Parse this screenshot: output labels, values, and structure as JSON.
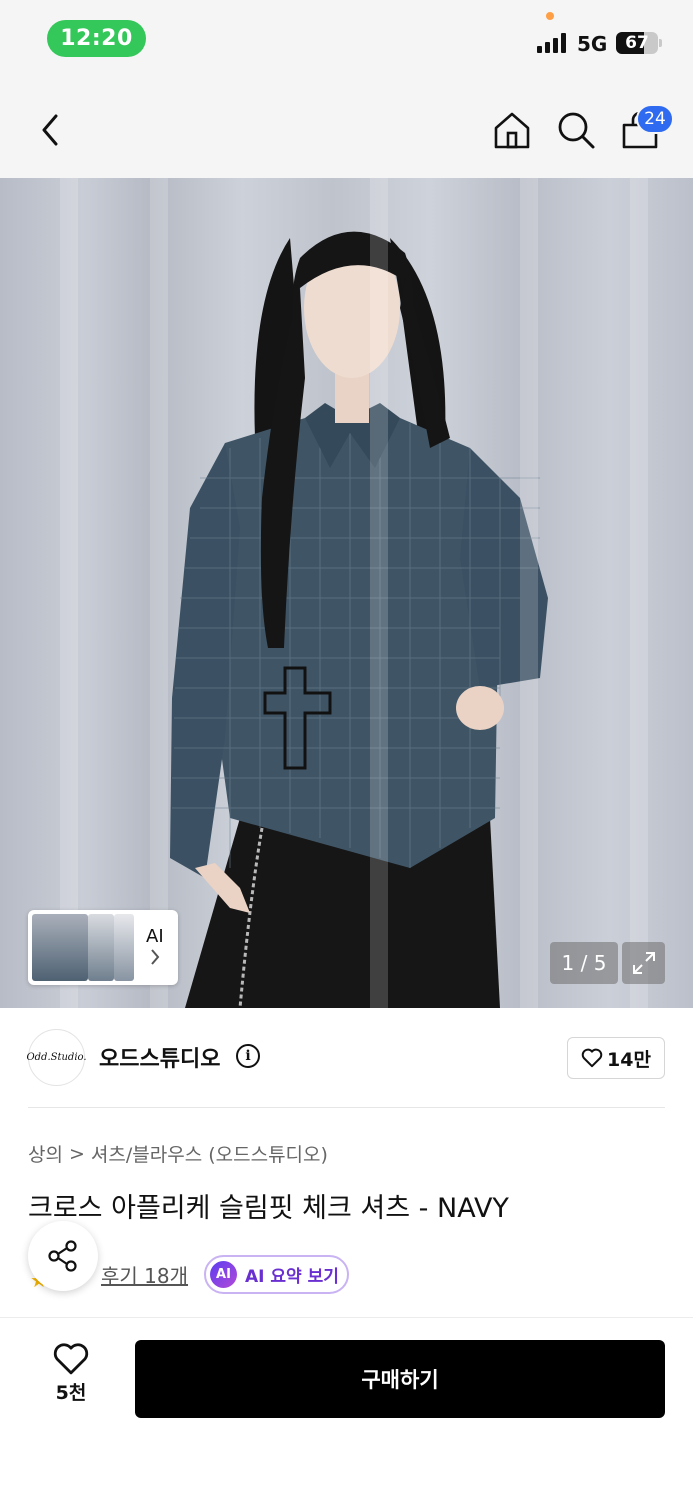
{
  "status_bar": {
    "time": "12:20",
    "network": "5G",
    "battery": "67",
    "battery_level": 0.67
  },
  "nav": {
    "back_icon": "chevron-left-icon",
    "home_icon": "home-icon",
    "search_icon": "search-icon",
    "cart_icon": "shopping-bag-icon",
    "cart_badge": "24"
  },
  "gallery": {
    "ai_label": "AI",
    "page_counter": "1 / 5",
    "expand_icon": "expand-icon"
  },
  "brand": {
    "logo_text": "Odd.Studio.",
    "name": "오드스튜디오",
    "info_icon": "i",
    "like_count": "14만"
  },
  "product": {
    "breadcrumb": [
      "상의",
      "셔츠/블라우스 (오드스튜디오)"
    ],
    "breadcrumb_separator": ">",
    "title": "크로스 아플리케 슬림핏 체크 셔츠 - NAVY",
    "review_link": "후기 18개",
    "ai_badge": "AI",
    "ai_summary": "AI 요약 보기"
  },
  "bottom_bar": {
    "wish_count": "5천",
    "buy_label": "구매하기"
  },
  "colors": {
    "accent_blue": "#2f6bf0",
    "status_green": "#34c759",
    "ai_purple": "#6a2fd0",
    "buy_button": "#000000"
  }
}
